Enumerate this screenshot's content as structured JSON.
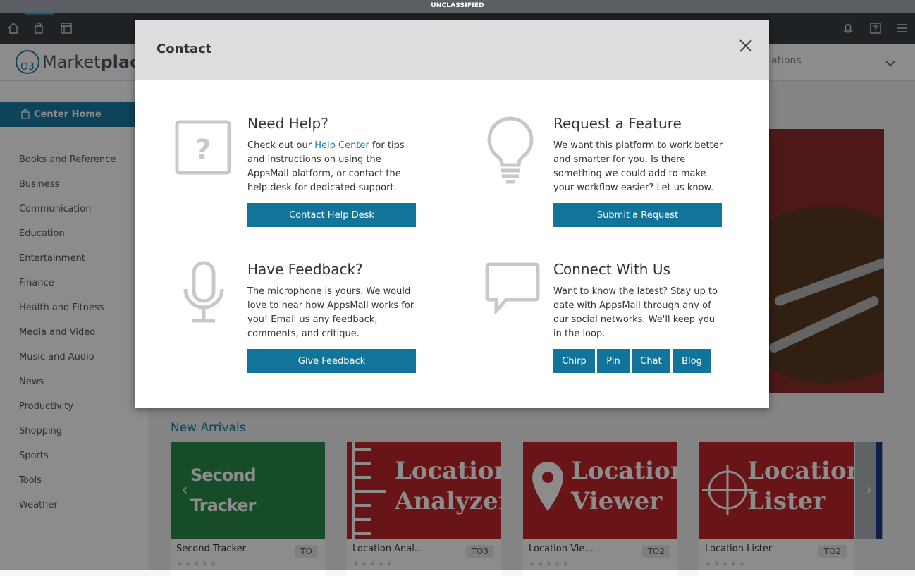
{
  "banner": "UNCLASSIFIED",
  "header": {
    "logo_o3": "O3",
    "logo_text_a": "Market",
    "logo_text_b": "place",
    "right_text": "ations"
  },
  "topbar": {
    "icons": [
      "home-icon",
      "bag-icon",
      "layout-icon",
      "bell-icon",
      "help-icon",
      "menu-icon"
    ]
  },
  "sidebar": {
    "center_home": "Center Home",
    "categories": [
      "Books and Reference",
      "Business",
      "Communication",
      "Education",
      "Entertainment",
      "Finance",
      "Health and Fitness",
      "Media and Video",
      "Music and Audio",
      "News",
      "Productivity",
      "Shopping",
      "Sports",
      "Tools",
      "Weather"
    ]
  },
  "main": {
    "new_arrivals": "New Arrivals",
    "cards": [
      {
        "image_text": "Second Tracker",
        "name": "Second Tracker",
        "badge": "TO"
      },
      {
        "image_text_1": "Location",
        "image_text_2": "Analyzer",
        "name": "Location Anal...",
        "badge": "TO3"
      },
      {
        "image_text_1": "Location",
        "image_text_2": "Viewer",
        "name": "Location Vie...",
        "badge": "TO2"
      },
      {
        "image_text_1": "Location",
        "image_text_2": "Lister",
        "name": "Location Lister",
        "badge": "TO2"
      }
    ],
    "stars": "★★★★★"
  },
  "modal": {
    "title": "Contact",
    "help": {
      "title": "Need Help?",
      "text_before": "Check out our ",
      "link": "Help Center",
      "text_after": " for tips and instructions on using the AppsMall platform, or contact the help desk for dedicated support.",
      "button": "Contact Help Desk"
    },
    "feature": {
      "title": "Request a Feature",
      "text": "We want this platform to work better and smarter for you. Is there something we could add to make your workflow easier? Let us know.",
      "button": "Submit a Request"
    },
    "feedback": {
      "title": "Have Feedback?",
      "text": "The microphone is yours. We would love to hear how AppsMall works for you! Email us any feedback, comments, and critique.",
      "button": "Give Feedback"
    },
    "connect": {
      "title": "Connect With Us",
      "text": "Want to know the latest? Stay up to date with AppsMall through any of our social networks. We'll keep you in the loop.",
      "buttons": [
        "Chirp",
        "Pin",
        "Chat",
        "Blog"
      ]
    }
  }
}
